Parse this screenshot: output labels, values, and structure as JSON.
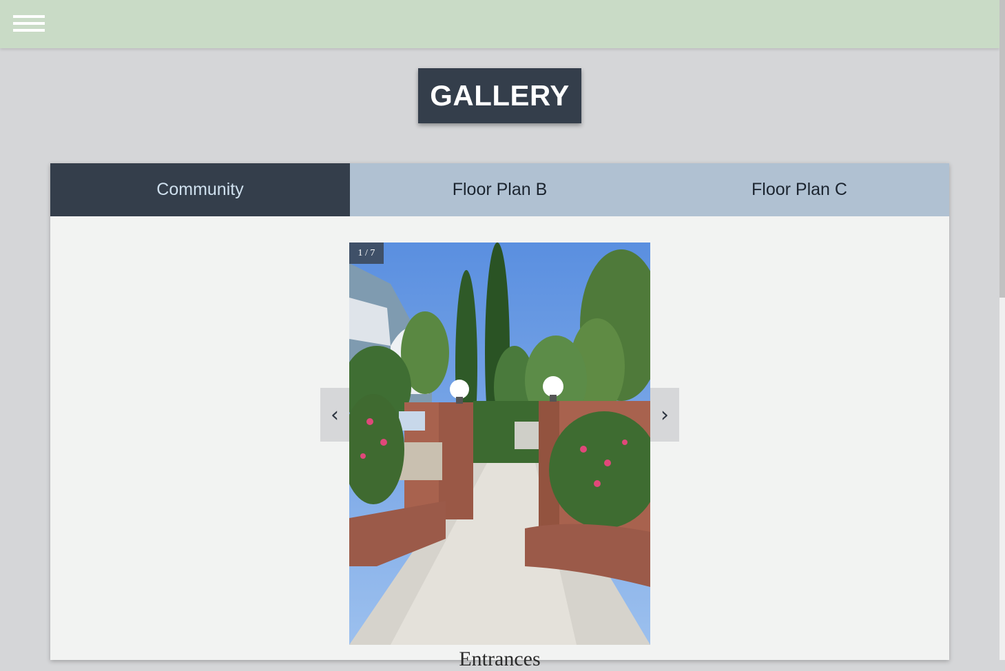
{
  "header": {
    "menu_icon": "hamburger-menu-icon"
  },
  "page": {
    "title": "GALLERY"
  },
  "tabs": [
    {
      "label": "Community",
      "active": true
    },
    {
      "label": "Floor Plan B",
      "active": false
    },
    {
      "label": "Floor Plan C",
      "active": false
    }
  ],
  "slideshow": {
    "counter": "1 / 7",
    "prev_symbol": "‹",
    "next_symbol": "›",
    "caption": "Entrances",
    "prev_icon": "chevron-left-icon",
    "next_icon": "chevron-right-icon"
  },
  "colors": {
    "topbar": "#c9dbc6",
    "title_bg": "#343e4b",
    "tab_active": "#343e4b",
    "tab_inactive": "#b0c1d2",
    "panel_bg": "#f2f3f2"
  }
}
